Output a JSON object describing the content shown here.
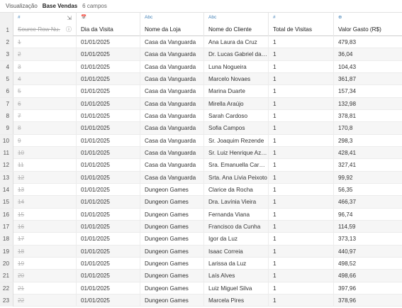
{
  "toolbar": {
    "view_label": "Visualização",
    "datasource_name": "Base Vendas",
    "field_count": "6 campos"
  },
  "columns": [
    {
      "name": "Source Row Nu...",
      "type_icon": "#",
      "type": "number",
      "removed": true
    },
    {
      "name": "Dia da Visita",
      "type_icon": "📅",
      "type": "date",
      "removed": false
    },
    {
      "name": "Nome da Loja",
      "type_icon": "Abc",
      "type": "string",
      "removed": false
    },
    {
      "name": "Nome do Cliente",
      "type_icon": "Abc",
      "type": "string",
      "removed": false
    },
    {
      "name": "Total de Visitas",
      "type_icon": "#",
      "type": "number",
      "removed": false
    },
    {
      "name": "Valor Gasto (R$)",
      "type_icon": "⊕",
      "type": "number",
      "removed": false
    }
  ],
  "header_row_number": "1",
  "rows": [
    {
      "n": "2",
      "src": "1",
      "dia": "01/01/2025",
      "loja": "Casa da Vanguarda",
      "cliente": "Ana Laura da Cruz",
      "visitas": "1",
      "valor": "479,83"
    },
    {
      "n": "3",
      "src": "2",
      "dia": "01/01/2025",
      "loja": "Casa da Vanguarda",
      "cliente": "Dr. Lucas Gabriel da R...",
      "visitas": "1",
      "valor": "36,04"
    },
    {
      "n": "4",
      "src": "3",
      "dia": "01/01/2025",
      "loja": "Casa da Vanguarda",
      "cliente": "Luna Nogueira",
      "visitas": "1",
      "valor": "104,43"
    },
    {
      "n": "5",
      "src": "4",
      "dia": "01/01/2025",
      "loja": "Casa da Vanguarda",
      "cliente": "Marcelo Novaes",
      "visitas": "1",
      "valor": "361,87"
    },
    {
      "n": "6",
      "src": "5",
      "dia": "01/01/2025",
      "loja": "Casa da Vanguarda",
      "cliente": "Marina Duarte",
      "visitas": "1",
      "valor": "157,34"
    },
    {
      "n": "7",
      "src": "6",
      "dia": "01/01/2025",
      "loja": "Casa da Vanguarda",
      "cliente": "Mirella Araújo",
      "visitas": "1",
      "valor": "132,98"
    },
    {
      "n": "8",
      "src": "7",
      "dia": "01/01/2025",
      "loja": "Casa da Vanguarda",
      "cliente": "Sarah Cardoso",
      "visitas": "1",
      "valor": "378,81"
    },
    {
      "n": "9",
      "src": "8",
      "dia": "01/01/2025",
      "loja": "Casa da Vanguarda",
      "cliente": "Sofia Campos",
      "visitas": "1",
      "valor": "170,8"
    },
    {
      "n": "10",
      "src": "9",
      "dia": "01/01/2025",
      "loja": "Casa da Vanguarda",
      "cliente": "Sr. Joaquim Rezende",
      "visitas": "1",
      "valor": "298,3"
    },
    {
      "n": "11",
      "src": "10",
      "dia": "01/01/2025",
      "loja": "Casa da Vanguarda",
      "cliente": "Sr. Luiz Henrique Azev...",
      "visitas": "1",
      "valor": "428,41"
    },
    {
      "n": "12",
      "src": "11",
      "dia": "01/01/2025",
      "loja": "Casa da Vanguarda",
      "cliente": "Sra. Emanuella Cardoso",
      "visitas": "1",
      "valor": "327,41"
    },
    {
      "n": "13",
      "src": "12",
      "dia": "01/01/2025",
      "loja": "Casa da Vanguarda",
      "cliente": "Srta. Ana Lívia Peixoto",
      "visitas": "1",
      "valor": "99,92"
    },
    {
      "n": "14",
      "src": "13",
      "dia": "01/01/2025",
      "loja": "Dungeon Games",
      "cliente": "Clarice da Rocha",
      "visitas": "1",
      "valor": "56,35"
    },
    {
      "n": "15",
      "src": "14",
      "dia": "01/01/2025",
      "loja": "Dungeon Games",
      "cliente": "Dra. Lavínia Vieira",
      "visitas": "1",
      "valor": "466,37"
    },
    {
      "n": "16",
      "src": "15",
      "dia": "01/01/2025",
      "loja": "Dungeon Games",
      "cliente": "Fernanda Viana",
      "visitas": "1",
      "valor": "96,74"
    },
    {
      "n": "17",
      "src": "16",
      "dia": "01/01/2025",
      "loja": "Dungeon Games",
      "cliente": "Francisco da Cunha",
      "visitas": "1",
      "valor": "114,59"
    },
    {
      "n": "18",
      "src": "17",
      "dia": "01/01/2025",
      "loja": "Dungeon Games",
      "cliente": "Igor da Luz",
      "visitas": "1",
      "valor": "373,13"
    },
    {
      "n": "19",
      "src": "18",
      "dia": "01/01/2025",
      "loja": "Dungeon Games",
      "cliente": "Isaac Correia",
      "visitas": "1",
      "valor": "440,97"
    },
    {
      "n": "20",
      "src": "19",
      "dia": "01/01/2025",
      "loja": "Dungeon Games",
      "cliente": "Larissa da Luz",
      "visitas": "1",
      "valor": "498,52"
    },
    {
      "n": "21",
      "src": "20",
      "dia": "01/01/2025",
      "loja": "Dungeon Games",
      "cliente": "Laís Alves",
      "visitas": "1",
      "valor": "498,66"
    },
    {
      "n": "22",
      "src": "21",
      "dia": "01/01/2025",
      "loja": "Dungeon Games",
      "cliente": "Luiz Miguel Silva",
      "visitas": "1",
      "valor": "397,96"
    },
    {
      "n": "23",
      "src": "22",
      "dia": "01/01/2025",
      "loja": "Dungeon Games",
      "cliente": "Marcela Pires",
      "visitas": "1",
      "valor": "378,96"
    }
  ],
  "icons": {
    "info": "info-icon",
    "exit": "exit-icon"
  },
  "colors": {
    "type_icon": "#3f7fb5",
    "alt_row": "#f6f6f6",
    "row_number_bg": "#f1f1f1",
    "removed_text": "#b5b5b5"
  }
}
